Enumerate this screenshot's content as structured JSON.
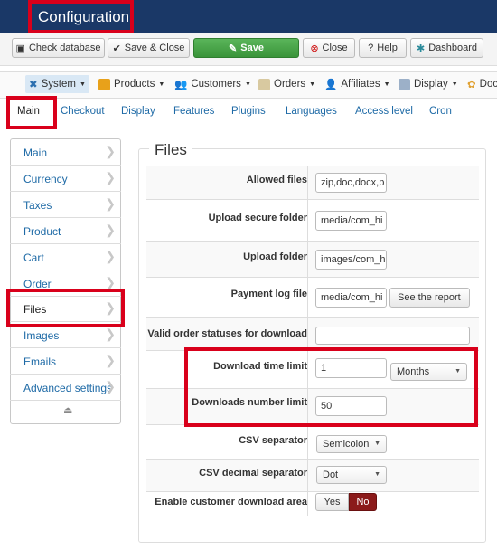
{
  "header": {
    "title": "Configuration"
  },
  "toolbar": {
    "check_database": "Check database",
    "save_close": "Save & Close",
    "save": "Save",
    "close": "Close",
    "help": "Help",
    "dashboard": "Dashboard"
  },
  "menu": {
    "items": [
      "System",
      "Products",
      "Customers",
      "Orders",
      "Affiliates",
      "Display",
      "Doc"
    ]
  },
  "tabs": [
    "Main",
    "Checkout",
    "Display",
    "Features",
    "Plugins",
    "Languages",
    "Access level",
    "Cron"
  ],
  "sidebar": {
    "items": [
      "Main",
      "Currency",
      "Taxes",
      "Product",
      "Cart",
      "Order",
      "Files",
      "Images",
      "Emails",
      "Advanced settings"
    ]
  },
  "form": {
    "legend": "Files",
    "allowed_files_label": "Allowed files",
    "allowed_files_value": "zip,doc,docx,p",
    "upload_secure_label": "Upload secure folder",
    "upload_secure_value": "media/com_hi",
    "upload_folder_label": "Upload folder",
    "upload_folder_value": "images/com_h",
    "payment_log_label": "Payment log file",
    "payment_log_value": "media/com_hi",
    "see_report": "See the report",
    "valid_status_label": "Valid order statuses for download",
    "valid_status_value": "",
    "download_time_label": "Download time limit",
    "download_time_value": "1",
    "download_time_unit": "Months",
    "downloads_number_label": "Downloads number limit",
    "downloads_number_value": "50",
    "csv_sep_label": "CSV separator",
    "csv_sep_value": "Semicolon",
    "csv_dec_label": "CSV decimal separator",
    "csv_dec_value": "Dot",
    "enable_area_label": "Enable customer download area",
    "yes": "Yes",
    "no": "No"
  },
  "colors": {
    "header": "#1a3867",
    "highlight": "#d9001b",
    "link": "#1e6aa6",
    "save_green": "#3a943a",
    "no_active": "#8b1a1a"
  }
}
